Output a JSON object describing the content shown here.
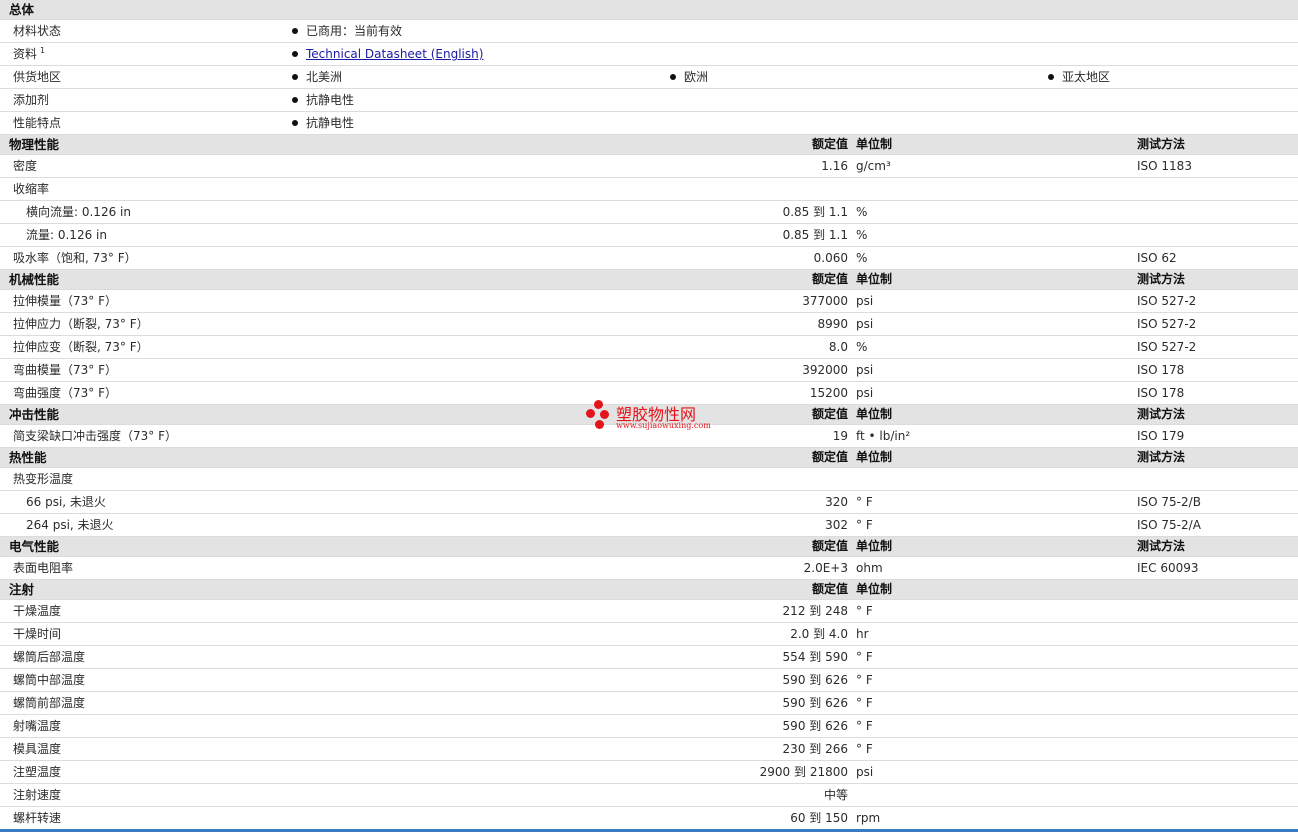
{
  "general": {
    "title": "总体",
    "material_status": {
      "label": "材料状态",
      "value": "已商用：当前有效"
    },
    "datasheet": {
      "label": "资料",
      "sup": "1",
      "link": "Technical Datasheet (English)"
    },
    "supply": {
      "label": "供货地区",
      "values": [
        "北美洲",
        "欧洲",
        "亚太地区"
      ]
    },
    "additive": {
      "label": "添加剂",
      "value": "抗静电性"
    },
    "features": {
      "label": "性能特点",
      "value": "抗静电性"
    }
  },
  "headers": {
    "nominal": "额定值",
    "unit": "单位制",
    "test": "测试方法"
  },
  "physical": {
    "title": "物理性能",
    "rows": [
      {
        "label": "密度",
        "value": "1.16",
        "unit": "g/cm³",
        "test": "ISO 1183"
      },
      {
        "label": "收缩率",
        "value": "",
        "unit": "",
        "test": ""
      },
      {
        "label": "横向流量: 0.126 in",
        "value": "0.85 到  1.1",
        "unit": "%",
        "test": ""
      },
      {
        "label": "流量: 0.126 in",
        "value": "0.85 到  1.1",
        "unit": "%",
        "test": ""
      },
      {
        "label": "吸水率（饱和, 73° F）",
        "value": "0.060",
        "unit": "%",
        "test": "ISO 62"
      }
    ]
  },
  "mechanical": {
    "title": "机械性能",
    "rows": [
      {
        "label": "拉伸模量（73° F）",
        "value": "377000",
        "unit": "psi",
        "test": "ISO 527-2"
      },
      {
        "label": "拉伸应力（断裂, 73° F）",
        "value": "8990",
        "unit": "psi",
        "test": "ISO 527-2"
      },
      {
        "label": "拉伸应变（断裂, 73° F）",
        "value": "8.0",
        "unit": "%",
        "test": "ISO 527-2"
      },
      {
        "label": "弯曲模量（73° F）",
        "value": "392000",
        "unit": "psi",
        "test": "ISO 178"
      },
      {
        "label": "弯曲强度（73° F）",
        "value": "15200",
        "unit": "psi",
        "test": "ISO 178"
      }
    ]
  },
  "impact": {
    "title": "冲击性能",
    "rows": [
      {
        "label": "简支梁缺口冲击强度（73° F）",
        "value": "19",
        "unit": "ft • lb/in²",
        "test": "ISO 179"
      }
    ]
  },
  "thermal": {
    "title": "热性能",
    "rows": [
      {
        "label": "热变形温度",
        "value": "",
        "unit": "",
        "test": ""
      },
      {
        "label": "66 psi, 未退火",
        "value": "320",
        "unit": "° F",
        "test": "ISO 75-2/B"
      },
      {
        "label": "264 psi, 未退火",
        "value": "302",
        "unit": "° F",
        "test": "ISO 75-2/A"
      }
    ]
  },
  "electrical": {
    "title": "电气性能",
    "rows": [
      {
        "label": "表面电阻率",
        "value": "2.0E+3",
        "unit": "ohm",
        "test": "IEC 60093"
      }
    ]
  },
  "injection": {
    "title": "注射",
    "rows": [
      {
        "label": "干燥温度",
        "value": "212 到  248",
        "unit": "° F"
      },
      {
        "label": "干燥时间",
        "value": "2.0 到  4.0",
        "unit": "hr"
      },
      {
        "label": "螺筒后部温度",
        "value": "554 到  590",
        "unit": "° F"
      },
      {
        "label": "螺筒中部温度",
        "value": "590 到  626",
        "unit": "° F"
      },
      {
        "label": "螺筒前部温度",
        "value": "590 到  626",
        "unit": "° F"
      },
      {
        "label": "射嘴温度",
        "value": "590 到  626",
        "unit": "° F"
      },
      {
        "label": "模具温度",
        "value": "230 到  266",
        "unit": "° F"
      },
      {
        "label": "注塑温度",
        "value": "2900 到  21800",
        "unit": "psi"
      },
      {
        "label": "注射速度",
        "value": "中等",
        "unit": ""
      },
      {
        "label": "螺杆转速",
        "value": "60 到  150",
        "unit": "rpm"
      }
    ]
  },
  "watermark": {
    "text": "塑胶物性网",
    "url": "www.sujiaowuxing.com",
    "color": "#e3141b"
  }
}
